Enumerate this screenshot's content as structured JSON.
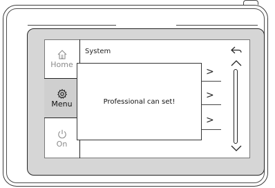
{
  "sidebar": {
    "home_label": "Home",
    "menu_label": "Menu",
    "on_label": "On",
    "icons": {
      "home": "home-icon",
      "menu": "gear-icon",
      "on": "power-icon"
    }
  },
  "screen": {
    "title": "System",
    "rows": [
      {
        "chevron": ">"
      },
      {
        "chevron": ">"
      },
      {
        "chevron": ">"
      }
    ],
    "back_icon": "back-arrow-icon",
    "scroll_up_icon": "chevron-up-icon",
    "scroll_down_icon": "chevron-down-icon"
  },
  "modal": {
    "message": "Professional can set!"
  }
}
